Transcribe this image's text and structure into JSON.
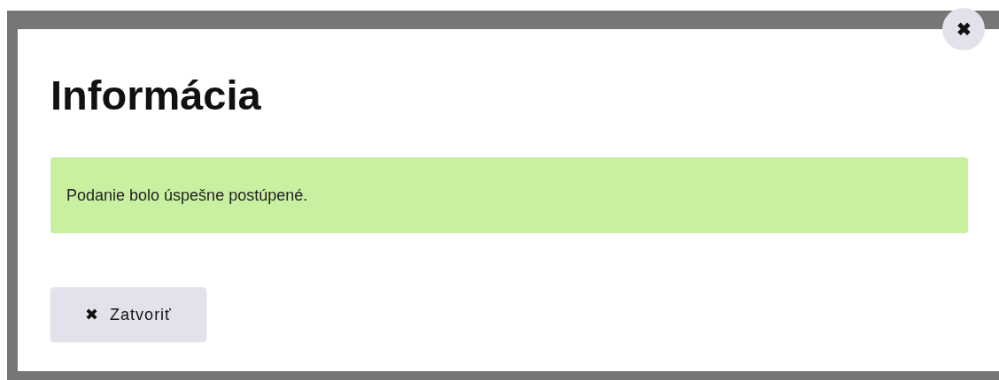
{
  "dialog": {
    "title": "Informácia",
    "message": "Podanie bolo úspešne postúpené.",
    "close_button": {
      "icon": "✖"
    },
    "buttons": [
      {
        "icon": "✖",
        "label": "Zatvoriť"
      }
    ]
  }
}
